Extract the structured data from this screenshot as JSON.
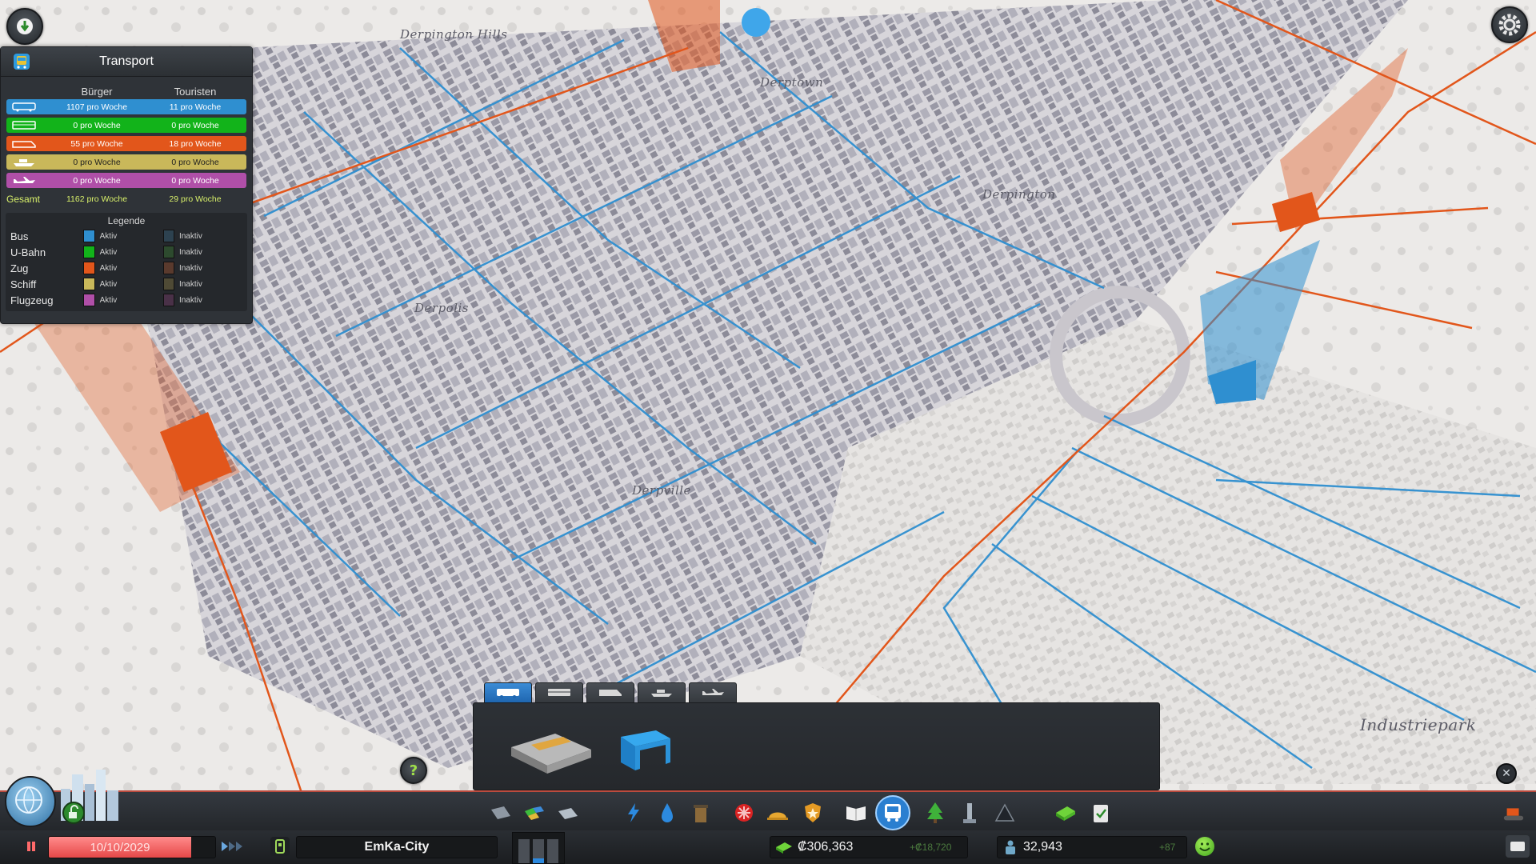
{
  "transport_panel": {
    "title": "Transport",
    "col_citizens": "Bürger",
    "col_tourists": "Touristen",
    "rows": [
      {
        "icon": "bus-icon",
        "citizens": "1107 pro Woche",
        "tourists": "11 pro Woche",
        "color": "#2f8fd0"
      },
      {
        "icon": "metro-icon",
        "citizens": "0 pro Woche",
        "tourists": "0 pro Woche",
        "color": "#12b31a"
      },
      {
        "icon": "train-icon",
        "citizens": "55 pro Woche",
        "tourists": "18 pro Woche",
        "color": "#e2561b"
      },
      {
        "icon": "ship-icon",
        "citizens": "0 pro Woche",
        "tourists": "0 pro Woche",
        "color": "#c9b85a"
      },
      {
        "icon": "plane-icon",
        "citizens": "0 pro Woche",
        "tourists": "0 pro Woche",
        "color": "#b04fa8"
      }
    ],
    "total_label": "Gesamt",
    "total_citizens": "1162 pro Woche",
    "total_tourists": "29 pro Woche",
    "legend_title": "Legende",
    "legend": [
      {
        "name": "Bus",
        "active": "Aktiv",
        "inactive": "Inaktiv",
        "active_color": "#2f8fd0",
        "inactive_color": "#2d4250"
      },
      {
        "name": "U-Bahn",
        "active": "Aktiv",
        "inactive": "Inaktiv",
        "active_color": "#12b31a",
        "inactive_color": "#2d4a2e"
      },
      {
        "name": "Zug",
        "active": "Aktiv",
        "inactive": "Inaktiv",
        "active_color": "#e2561b",
        "inactive_color": "#5a3a2d"
      },
      {
        "name": "Schiff",
        "active": "Aktiv",
        "inactive": "Inaktiv",
        "active_color": "#c9b85a",
        "inactive_color": "#4f4a35"
      },
      {
        "name": "Flugzeug",
        "active": "Aktiv",
        "inactive": "Inaktiv",
        "active_color": "#b04fa8",
        "inactive_color": "#4a3148"
      }
    ]
  },
  "map_labels": {
    "hills": "Derpington Hills",
    "derptown": "Derptown",
    "derpington": "Derpington",
    "derpolis": "Derpolis",
    "derpville": "Derpville",
    "industrie": "Industriepark"
  },
  "status": {
    "date": "10/10/2029",
    "city_name": "EmKa-City",
    "money": "₡306,363",
    "money_delta": "+₡18,720",
    "population": "32,943",
    "population_delta": "+87"
  },
  "colors": {
    "bus_line": "#2f8fd0",
    "train_line": "#e2561b",
    "accent_blue": "#2a7fd0"
  }
}
